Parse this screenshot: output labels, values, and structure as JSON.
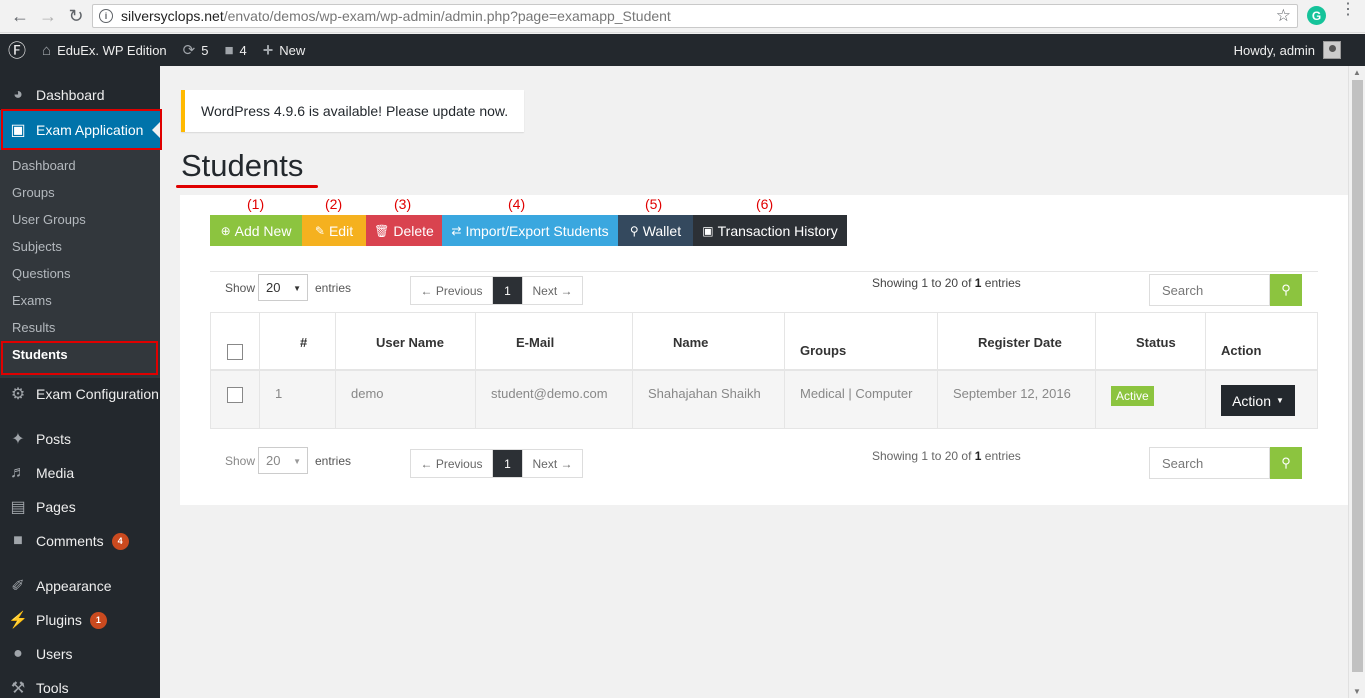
{
  "browser": {
    "url_host": "silversyclops.net",
    "url_path": "/envato/demos/wp-exam/wp-admin/admin.php?page=examapp_Student",
    "extension_letter": "G"
  },
  "admin_bar": {
    "site_name": "EduEx. WP Edition",
    "updates_count": "5",
    "comments_count": "4",
    "new_label": "New",
    "howdy": "Howdy, admin"
  },
  "sidebar": {
    "dashboard": "Dashboard",
    "exam_application": "Exam Application",
    "submenu": [
      "Dashboard",
      "Groups",
      "User Groups",
      "Subjects",
      "Questions",
      "Exams",
      "Results",
      "Students"
    ],
    "exam_configuration": "Exam Configuration",
    "posts": "Posts",
    "media": "Media",
    "pages": "Pages",
    "comments": "Comments",
    "comments_badge": "4",
    "appearance": "Appearance",
    "plugins": "Plugins",
    "plugins_badge": "1",
    "users": "Users",
    "tools": "Tools"
  },
  "notice": "WordPress 4.9.6 is available! Please update now.",
  "page_title": "Students",
  "annotations": [
    "(1)",
    "(2)",
    "(3)",
    "(4)",
    "(5)",
    "(6)"
  ],
  "toolbar": {
    "add_new": "Add New",
    "edit": "Edit",
    "delete": "Delete",
    "import_export": "Import/Export Students",
    "wallet": "Wallet",
    "transaction_history": "Transaction History"
  },
  "controls": {
    "show_label": "Show",
    "entries_label": "entries",
    "page_size": "20",
    "prev_label": "← Previous",
    "next_label": "Next →",
    "current_page": "1",
    "showing_prefix": "Showing 1 to 20 of ",
    "showing_total": "1",
    "showing_suffix": " entries",
    "search_placeholder": "Search"
  },
  "table": {
    "headers": [
      "#",
      "User Name",
      "E-Mail",
      "Name",
      "Groups",
      "Register Date",
      "Status",
      "Action"
    ],
    "rows": [
      {
        "num": "1",
        "username": "demo",
        "email": "student@demo.com",
        "name": "Shahajahan Shaikh",
        "groups": "Medical | Computer",
        "register_date": "September 12, 2016",
        "status": "Active",
        "action": "Action"
      }
    ]
  }
}
